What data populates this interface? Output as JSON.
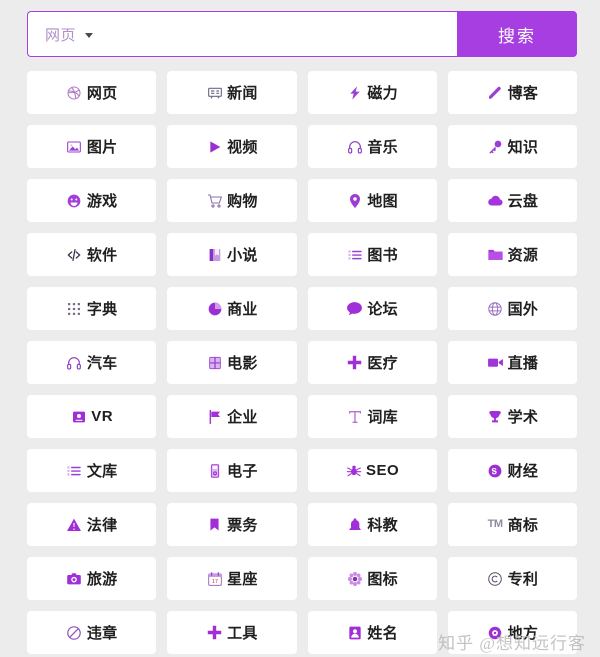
{
  "search": {
    "category_label": "网页",
    "category_icon": "chevron-down-icon",
    "input_value": "",
    "placeholder": "",
    "button_label": "搜索",
    "accent_color": "#a73ee2",
    "border_color": "#a43fe0"
  },
  "colors": {
    "background": "#ececec",
    "card": "#ffffff",
    "icon_purple": "#9b3fd4",
    "label_text": "#1f1f1f",
    "watermark": "#b9b9b9"
  },
  "watermark": {
    "text": "知乎 @想知远行客"
  },
  "grid": {
    "columns": 4,
    "items": [
      {
        "label": "网页",
        "icon": "dribbble-web-icon"
      },
      {
        "label": "新闻",
        "icon": "newspaper-icon"
      },
      {
        "label": "磁力",
        "icon": "lightning-bolt-icon"
      },
      {
        "label": "博客",
        "icon": "pencil-icon"
      },
      {
        "label": "图片",
        "icon": "image-icon"
      },
      {
        "label": "视频",
        "icon": "play-triangle-icon"
      },
      {
        "label": "音乐",
        "icon": "headphones-icon"
      },
      {
        "label": "知识",
        "icon": "key-icon"
      },
      {
        "label": "游戏",
        "icon": "smiley-face-icon"
      },
      {
        "label": "购物",
        "icon": "shopping-cart-icon"
      },
      {
        "label": "地图",
        "icon": "map-pin-icon"
      },
      {
        "label": "云盘",
        "icon": "cloud-icon"
      },
      {
        "label": "软件",
        "icon": "code-brackets-icon"
      },
      {
        "label": "小说",
        "icon": "book-icon"
      },
      {
        "label": "图书",
        "icon": "list-bullets-icon"
      },
      {
        "label": "资源",
        "icon": "folder-icon"
      },
      {
        "label": "字典",
        "icon": "grid-dots-icon"
      },
      {
        "label": "商业",
        "icon": "pie-chart-icon"
      },
      {
        "label": "论坛",
        "icon": "speech-bubble-icon"
      },
      {
        "label": "国外",
        "icon": "globe-icon"
      },
      {
        "label": "汽车",
        "icon": "headphones-icon"
      },
      {
        "label": "电影",
        "icon": "film-strip-icon"
      },
      {
        "label": "医疗",
        "icon": "plus-cross-icon"
      },
      {
        "label": "直播",
        "icon": "video-camera-icon"
      },
      {
        "label": "VR",
        "icon": "vr-box-icon",
        "latin": true
      },
      {
        "label": "企业",
        "icon": "flag-icon"
      },
      {
        "label": "词库",
        "icon": "text-t-icon"
      },
      {
        "label": "学术",
        "icon": "trophy-icon"
      },
      {
        "label": "文库",
        "icon": "list-bullets-icon"
      },
      {
        "label": "电子",
        "icon": "mp3-player-icon"
      },
      {
        "label": "SEO",
        "icon": "spider-bug-icon",
        "latin": true
      },
      {
        "label": "财经",
        "icon": "skype-circle-icon"
      },
      {
        "label": "法律",
        "icon": "warning-triangle-icon"
      },
      {
        "label": "票务",
        "icon": "bookmark-icon"
      },
      {
        "label": "科教",
        "icon": "bell-icon"
      },
      {
        "label": "商标",
        "icon": "tm-text-icon"
      },
      {
        "label": "旅游",
        "icon": "camera-icon"
      },
      {
        "label": "星座",
        "icon": "calendar-icon"
      },
      {
        "label": "图标",
        "icon": "flower-gear-icon"
      },
      {
        "label": "专利",
        "icon": "copyright-icon"
      },
      {
        "label": "违章",
        "icon": "no-entry-icon"
      },
      {
        "label": "工具",
        "icon": "plus-cross-icon"
      },
      {
        "label": "姓名",
        "icon": "person-badge-icon"
      },
      {
        "label": "地方",
        "icon": "location-circle-icon"
      }
    ]
  }
}
